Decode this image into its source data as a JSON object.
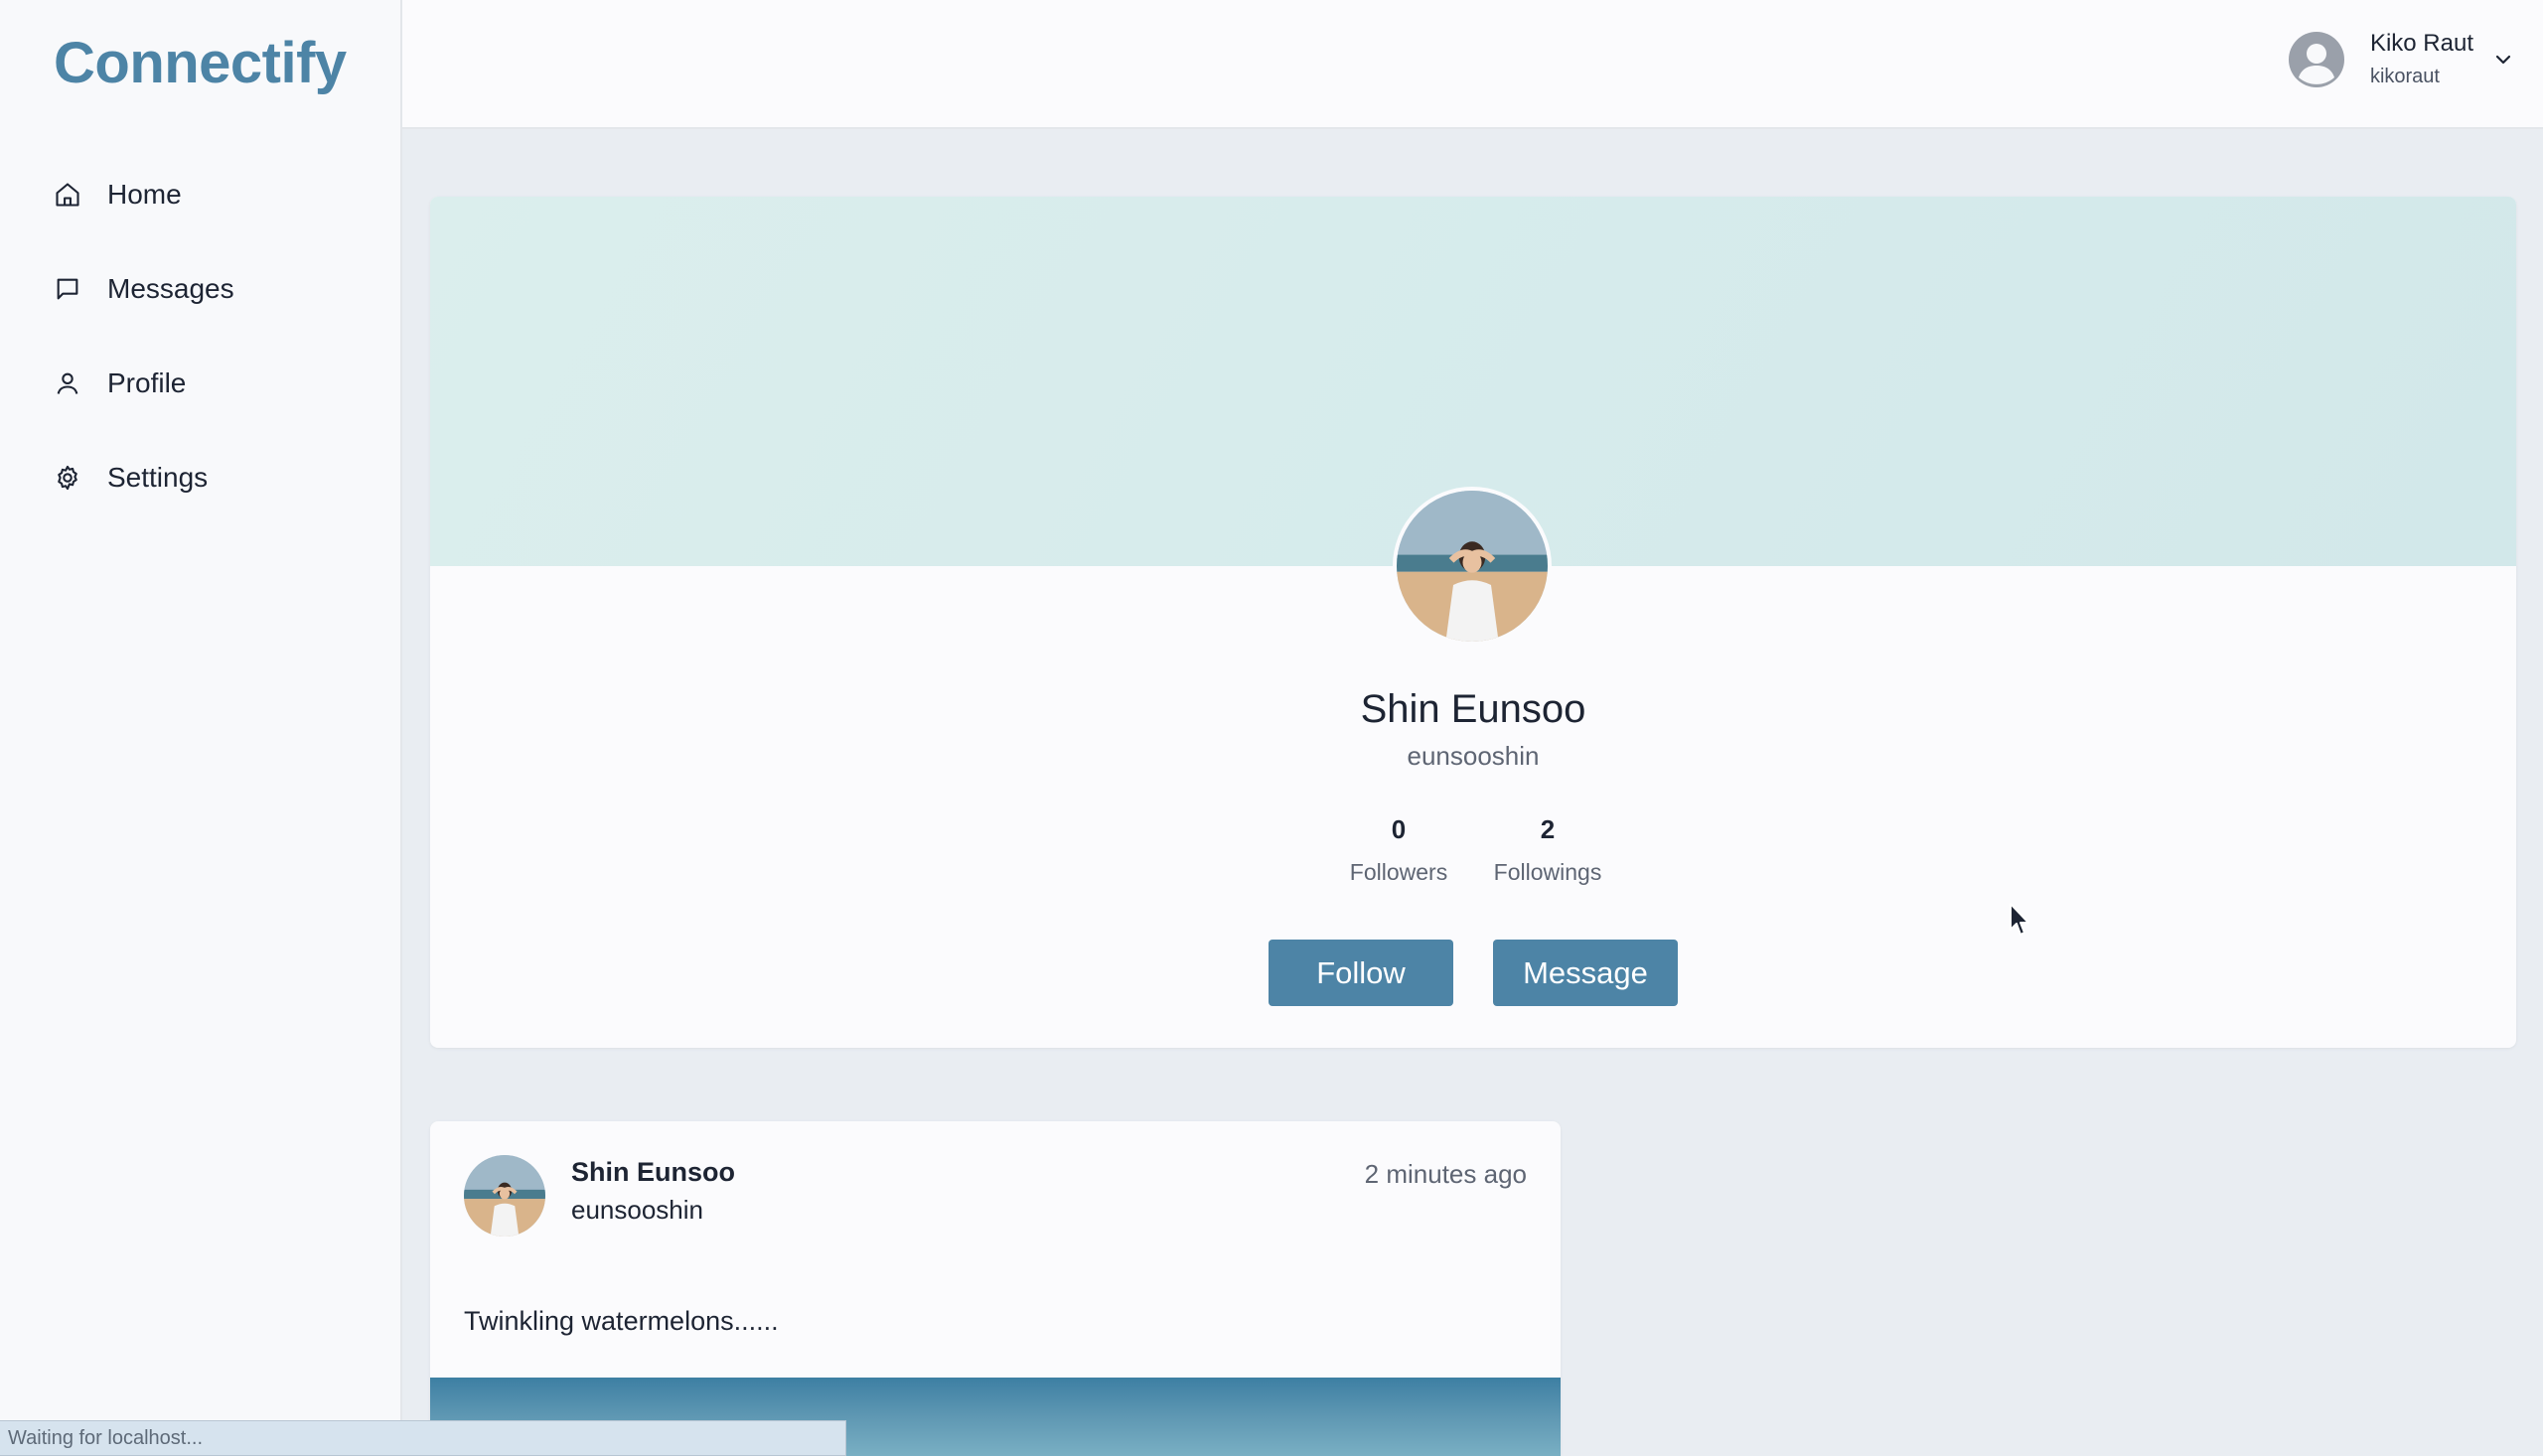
{
  "app": {
    "name": "Connectify"
  },
  "sidebar": {
    "items": [
      {
        "label": "Home",
        "icon": "home-icon"
      },
      {
        "label": "Messages",
        "icon": "message-square-icon"
      },
      {
        "label": "Profile",
        "icon": "user-icon"
      },
      {
        "label": "Settings",
        "icon": "gear-icon"
      }
    ]
  },
  "header": {
    "user": {
      "name": "Kiko Raut",
      "handle": "kikoraut",
      "icon": "user-circle-icon"
    }
  },
  "profile": {
    "name": "Shin Eunsoo",
    "handle": "eunsooshin",
    "followers_count": "0",
    "followers_label": "Followers",
    "followings_count": "2",
    "followings_label": "Followings",
    "follow_label": "Follow",
    "message_label": "Message"
  },
  "post": {
    "author": "Shin Eunsoo",
    "handle": "eunsooshin",
    "time": "2 minutes ago",
    "text": "Twinkling watermelons......"
  },
  "status_bar": {
    "text": "Waiting for localhost..."
  },
  "colors": {
    "accent": "#4d84a6",
    "banner": "#d7ecec",
    "background": "#e9edf2"
  }
}
